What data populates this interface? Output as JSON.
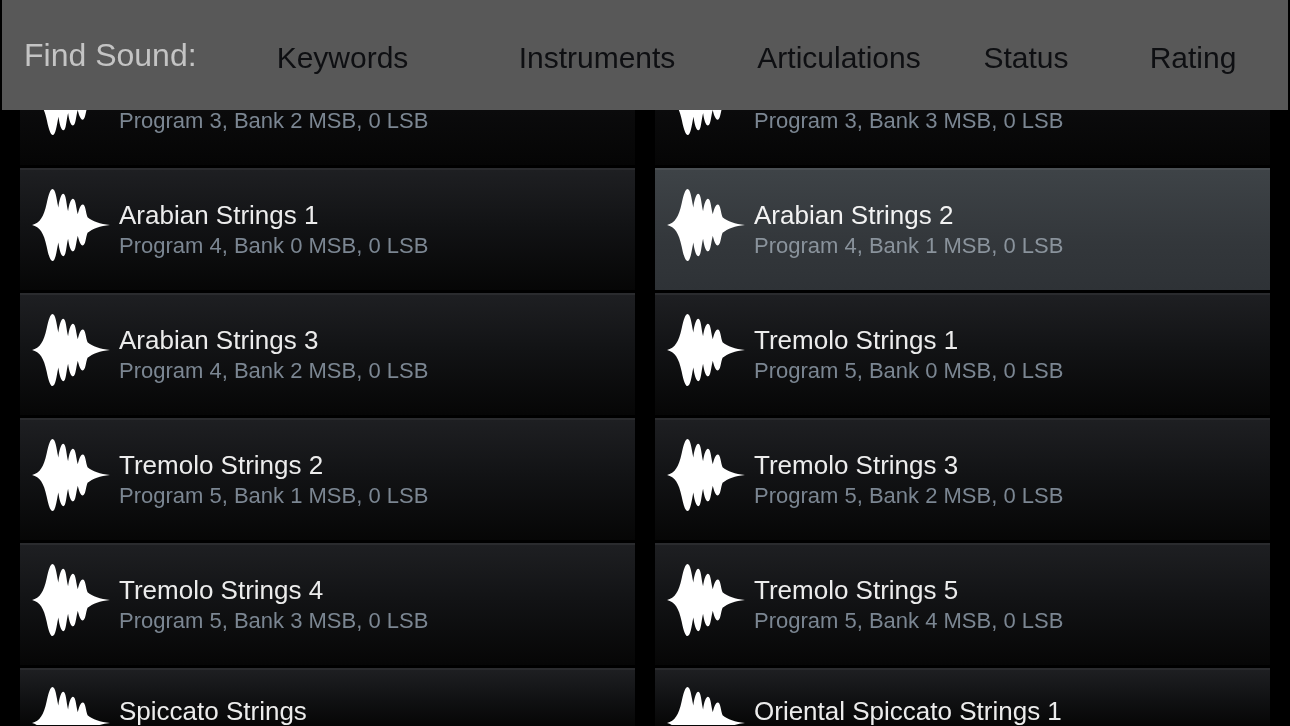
{
  "filter_bar": {
    "label": "Find Sound:",
    "tabs": [
      {
        "label": "Keywords"
      },
      {
        "label": "Instruments"
      },
      {
        "label": "Articulations"
      },
      {
        "label": "Status"
      },
      {
        "label": "Rating"
      }
    ]
  },
  "sounds": [
    {
      "subtitle": "Program 3, Bank 2 MSB, 0 LSB",
      "selected": false
    },
    {
      "subtitle": "Program 3, Bank 3 MSB, 0 LSB",
      "selected": false
    },
    {
      "name": "Arabian Strings 1",
      "subtitle": "Program 4, Bank 0 MSB, 0 LSB",
      "selected": false
    },
    {
      "name": "Arabian Strings 2",
      "subtitle": "Program 4, Bank 1 MSB, 0 LSB",
      "selected": true
    },
    {
      "name": "Arabian Strings 3",
      "subtitle": "Program 4, Bank 2 MSB, 0 LSB",
      "selected": false
    },
    {
      "name": "Tremolo Strings 1",
      "subtitle": "Program 5, Bank 0 MSB, 0 LSB",
      "selected": false
    },
    {
      "name": "Tremolo Strings 2",
      "subtitle": "Program 5, Bank 1 MSB, 0 LSB",
      "selected": false
    },
    {
      "name": "Tremolo Strings 3",
      "subtitle": "Program 5, Bank 2 MSB, 0 LSB",
      "selected": false
    },
    {
      "name": "Tremolo Strings 4",
      "subtitle": "Program 5, Bank 3 MSB, 0 LSB",
      "selected": false
    },
    {
      "name": "Tremolo Strings 5",
      "subtitle": "Program 5, Bank 4 MSB, 0 LSB",
      "selected": false
    },
    {
      "name": "Spiccato Strings",
      "selected": false
    },
    {
      "name": "Oriental Spiccato Strings 1",
      "selected": false
    }
  ]
}
